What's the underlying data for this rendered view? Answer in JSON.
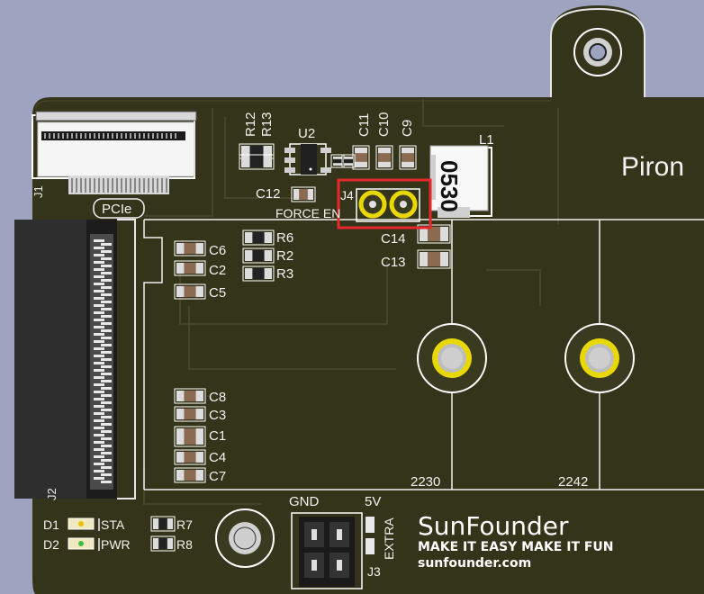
{
  "board": {
    "title_partial": "Piron",
    "logo": {
      "brand": "SunFounder",
      "tagline": "MAKE IT EASY MAKE IT FUN",
      "url": "sunfounder.com"
    },
    "force_en_label": "FORCE EN",
    "pcie_label": "PCIe",
    "inductor": {
      "ref": "L1",
      "marking": "0530"
    },
    "size_labels": [
      "2230",
      "2242"
    ],
    "header_labels": {
      "gnd": "GND",
      "v5": "5V",
      "extra": "EXTRA",
      "ref": "J3"
    },
    "leds": {
      "d1": {
        "ref": "D1",
        "label": "STA"
      },
      "d2": {
        "ref": "D2",
        "label": "PWR"
      }
    },
    "refs": {
      "j1": "J1",
      "j4": "J4",
      "j2": "J2",
      "u2": "U2",
      "r12": "R12",
      "r13": "R13",
      "c11": "C11",
      "c10": "C10",
      "c9": "C9",
      "c12": "C12",
      "c14": "C14",
      "c13": "C13",
      "c6": "C6",
      "c2": "C2",
      "c5": "C5",
      "r6": "R6",
      "r2": "R2",
      "r3": "R3",
      "c8": "C8",
      "c3": "C3",
      "c1": "C1",
      "c4": "C4",
      "c7": "C7",
      "r7": "R7",
      "r8": "R8"
    },
    "colors": {
      "background": "#9ea3c0",
      "board": "#34341a",
      "silkscreen": "#f2f2f2",
      "pad_gold": "#e8d800",
      "highlight": "#e8282c"
    }
  }
}
